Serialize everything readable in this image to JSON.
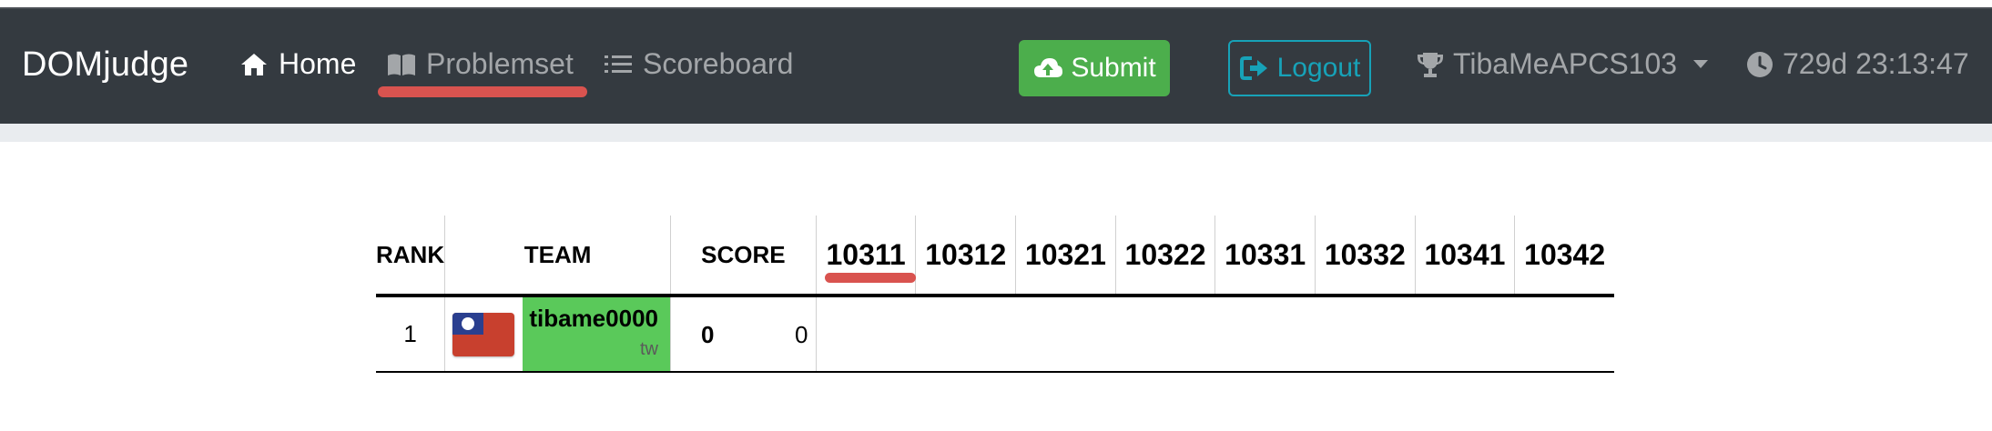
{
  "navbar": {
    "brand": "DOMjudge",
    "links": [
      {
        "label": "Home",
        "icon": "home-icon"
      },
      {
        "label": "Problemset",
        "icon": "book-icon"
      },
      {
        "label": "Scoreboard",
        "icon": "list-icon"
      }
    ],
    "submit_label": "Submit",
    "logout_label": "Logout",
    "user_name": "TibaMeAPCS103",
    "countdown": "729d 23:13:47",
    "colors": {
      "navbar_bg": "#343a40",
      "submit_bg": "#4cae4c",
      "logout_border": "#17a2b8",
      "annotation": "#d9534f"
    }
  },
  "scoreboard": {
    "headers": {
      "rank": "RANK",
      "team": "TEAM",
      "score": "SCORE"
    },
    "problems": [
      "10311",
      "10312",
      "10321",
      "10322",
      "10331",
      "10332",
      "10341",
      "10342"
    ],
    "rows": [
      {
        "rank": "1",
        "team_name": "tibame0000",
        "affiliation": "tw",
        "solved": "0",
        "penalty": "0",
        "flag": "taiwan-flag-icon"
      }
    ],
    "colors": {
      "team_cell_bg": "#5ac95a"
    }
  }
}
